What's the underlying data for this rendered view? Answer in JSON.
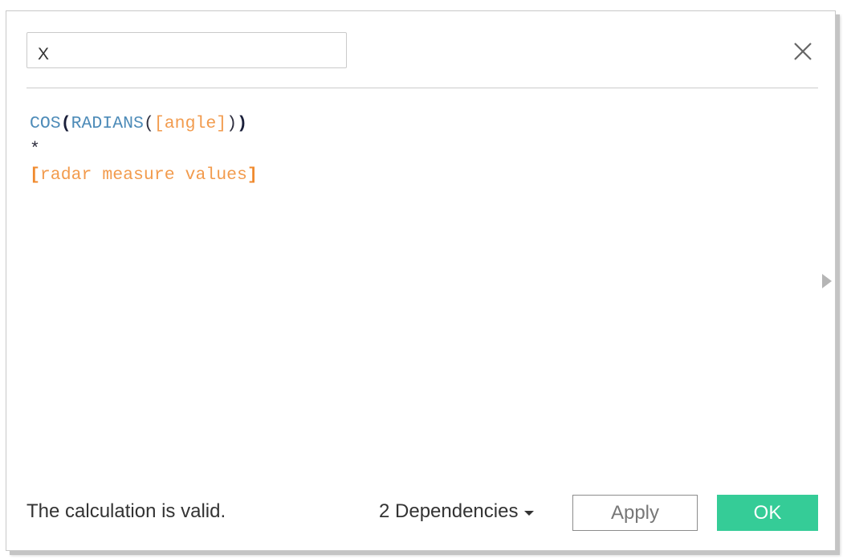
{
  "dialog": {
    "calc_name": "X",
    "close_icon": "close-icon",
    "formula": {
      "line1": {
        "fn1": "COS",
        "open1": "(",
        "fn2": "RADIANS",
        "open2": "(",
        "field1": "[angle]",
        "close2": ")",
        "close1": ")"
      },
      "line2": {
        "operator": "*"
      },
      "line3": {
        "open_bracket": "[",
        "field2": "radar measure values",
        "close_bracket": "]"
      }
    },
    "expand_icon": "triangle-right-icon",
    "status_text": "The calculation is valid.",
    "dependencies_label": "2 Dependencies",
    "dependencies_icon": "caret-down-icon",
    "apply_label": "Apply",
    "ok_label": "OK",
    "colors": {
      "function": "#4d8bb8",
      "field": "#f29b4d",
      "ok_button": "#35cc97"
    }
  }
}
